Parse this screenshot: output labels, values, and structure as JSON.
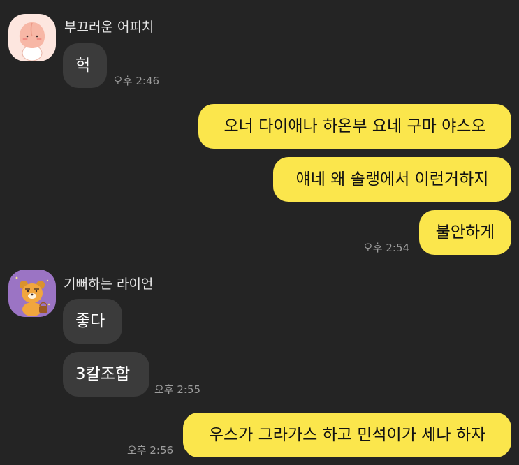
{
  "chat": {
    "groups": [
      {
        "sender": "부끄러운 어피치",
        "avatar_icon": "apeach-avatar-icon",
        "messages": [
          "헉"
        ],
        "time": "오후 2:46"
      },
      {
        "outgoing": true,
        "messages": [
          "오너 다이애나 하온부 요네 구마 야스오",
          "얘네 왜 솔랭에서 이런거하지",
          "불안하게"
        ],
        "time": "오후 2:54"
      },
      {
        "sender": "기뻐하는 라이언",
        "avatar_icon": "ryan-avatar-icon",
        "messages": [
          "좋다",
          "3칼조합"
        ],
        "time": "오후 2:55"
      },
      {
        "outgoing": true,
        "messages": [
          "우스가 그라가스 하고 민석이가 세나 하자"
        ],
        "time": "오후 2:56"
      }
    ]
  },
  "colors": {
    "background": "#242424",
    "incoming_bubble": "#3b3b3b",
    "outgoing_bubble": "#fbe64c",
    "time_text": "#9d9d9d"
  }
}
